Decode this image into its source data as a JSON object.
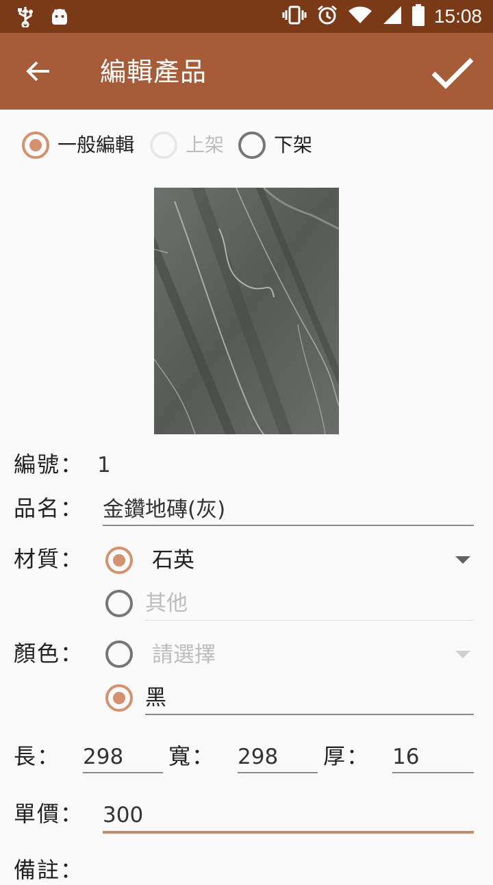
{
  "status_bar": {
    "time": "15:08"
  },
  "app_bar": {
    "title": "編輯產品"
  },
  "mode": {
    "options": [
      {
        "label": "一般編輯",
        "state": "checked"
      },
      {
        "label": "上架",
        "state": "disabled"
      },
      {
        "label": "下架",
        "state": "unchecked"
      }
    ]
  },
  "form": {
    "id_label": "編號：",
    "id_value": "1",
    "name_label": "品名：",
    "name_value": "金鑽地磚(灰)",
    "material_label": "材質：",
    "material_selected": "石英",
    "material_other_placeholder": "其他",
    "color_label": "顏色：",
    "color_select_placeholder": "請選擇",
    "color_other_value": "黑",
    "length_label": "長：",
    "length_value": "298",
    "width_label": "寬：",
    "width_value": "298",
    "thickness_label": "厚：",
    "thickness_value": "16",
    "price_label": "單價：",
    "price_value": "300",
    "notes_label": "備註："
  },
  "colors": {
    "accent": "#d4916f",
    "app_bar": "#a65c38",
    "status_bar": "#7a3a18"
  }
}
